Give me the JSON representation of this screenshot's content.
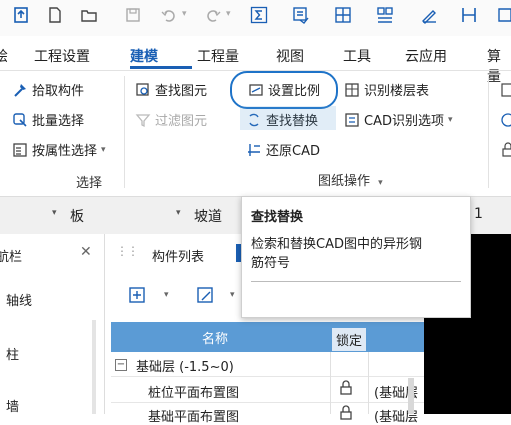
{
  "ribbon_tabs": [
    "工程设置",
    "建模",
    "工程量",
    "视图",
    "工具",
    "云应用",
    "算量"
  ],
  "ribbon_tab_partial_left": "绘",
  "active_tab": "建模",
  "select_group": {
    "pick": "拾取构件",
    "batch": "批量选择",
    "by_attr": "按属性选择",
    "title": "选择"
  },
  "drawing_group": {
    "find_element": "查找图元",
    "filter_element": "过滤图元",
    "set_scale": "设置比例",
    "find_replace": "查找替换",
    "restore_cad": "还原CAD",
    "identify_floor": "识别楼层表",
    "cad_options": "CAD识别选项",
    "title": "图纸操作"
  },
  "toolbar2": {
    "slab": "板",
    "ramp": "坡道",
    "partial_right": "1"
  },
  "nav_panel": {
    "title": "航栏",
    "items": [
      "轴线",
      "柱",
      "墙"
    ]
  },
  "component_panel": {
    "tab_list": "构件列表",
    "columns": [
      "名称",
      "锁定"
    ],
    "group_row": "基础层 (-1.5~0)",
    "rows": [
      {
        "name": "桩位平面布置图",
        "extra": "(基础层"
      },
      {
        "name": "基础平面布置图",
        "extra": "(基础层"
      }
    ]
  },
  "tooltip": {
    "title": "查找替换",
    "body_line1": "检索和替换CAD图中的异形钢",
    "body_line2": "筋符号"
  },
  "colors": {
    "accent": "#1a5fb4",
    "highlight_circle": "#1e73c8",
    "header_blue": "#5b9bd5"
  }
}
